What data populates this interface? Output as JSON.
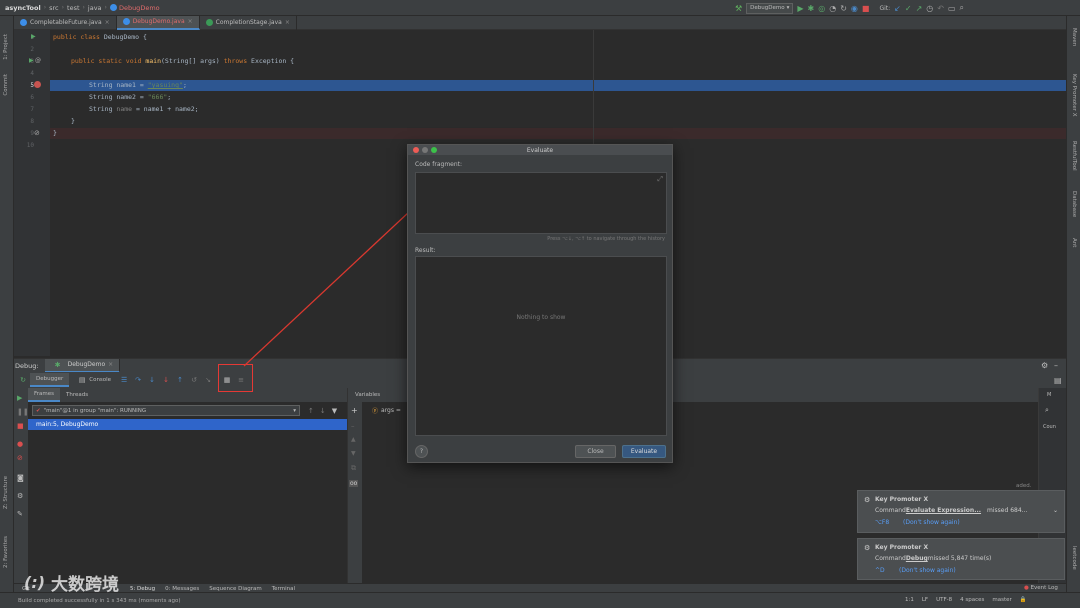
{
  "toolbar": {
    "project": "asyncTool",
    "crumbs": [
      "src",
      "test",
      "java"
    ],
    "file": "DebugDemo",
    "run_config": "DebugDemo",
    "git_label": "Git:"
  },
  "tabs": [
    {
      "label": "CompletableFuture.java"
    },
    {
      "label": "DebugDemo.java"
    },
    {
      "label": "CompletionStage.java"
    }
  ],
  "left_tools": [
    "1: Project",
    "Commit",
    "Z: Structure",
    "2: Favorites"
  ],
  "right_tools": [
    "Maven",
    "Key Promoter X",
    "RestfulTool",
    "Database",
    "Ant",
    "leetcode"
  ],
  "editor": {
    "line_numbers": [
      "1",
      "2",
      "3",
      "4",
      "5",
      "6",
      "7",
      "8",
      "9",
      "10"
    ],
    "lines": {
      "l1a": "public class ",
      "l1b": "DebugDemo {",
      "l3a": "public static void ",
      "l3b": "main",
      "l3c": "(String[] args) ",
      "l3d": "throws ",
      "l3e": "Exception {",
      "l5a": "String name1 = ",
      "l5b": "\"yasuing\"",
      ";": ";",
      "l6a": "String name2 = ",
      "l6b": "\"666\"",
      "l7a": "String ",
      "l7b": "name",
      " l7c": " = name1 + name2;",
      "l8": "}",
      "l9": "}"
    }
  },
  "debug": {
    "label": "Debug:",
    "config": "DebugDemo",
    "debugger_tab": "Debugger",
    "console_tab": "Console",
    "frames_tab": "Frames",
    "threads_tab": "Threads",
    "thread": "\"main\"@1 in group \"main\": RUNNING",
    "frame": "main:5, DebugDemo",
    "variables_label": "Variables",
    "var_args": "args =",
    "loaded": "aded.",
    "count": "Coun",
    "m": "M"
  },
  "dialog": {
    "title": "Evaluate",
    "code_fragment": "Code fragment:",
    "hint": "Press ⌥↓, ⌥↑ to navigate through the history",
    "result": "Result:",
    "empty": "Nothing to show",
    "help": "?",
    "close": "Close",
    "evaluate": "Evaluate"
  },
  "notifications": [
    {
      "title": "Key Promoter X",
      "cmd_prefix": "Command ",
      "cmd": "Evaluate Expression...",
      "suffix": "missed 684...",
      "shortcut": "⌥F8",
      "dont": "(Don't show again)"
    },
    {
      "title": "Key Promoter X",
      "cmd_prefix": "Command ",
      "cmd": "Debug",
      "suffix": " missed 5,847 time(s)",
      "shortcut": "^D",
      "dont": "(Don't show again)"
    }
  ],
  "bottom_tabs": [
    "Git",
    "5: Debug",
    "0: Messages",
    "Sequence Diagram",
    "Terminal"
  ],
  "event_log": "Event Log",
  "status": {
    "message": "Build completed successfully in 1 s 343 ms (moments ago)",
    "position": "1:1",
    "lf": "LF",
    "encoding": "UTF-8",
    "indent": "4 spaces",
    "branch": "master"
  },
  "watermark": "大数跨境"
}
